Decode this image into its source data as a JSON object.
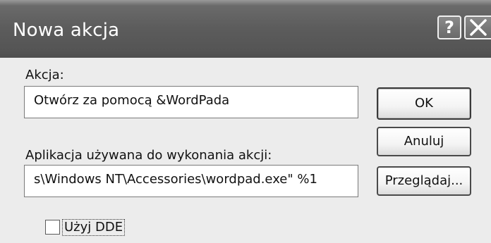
{
  "window": {
    "title": "Nowa akcja",
    "help_button": "?"
  },
  "form": {
    "action_label": "Akcja:",
    "action_value": "Otwórz za pomocą &WordPada",
    "app_label": "Aplikacja używana do wykonania akcji:",
    "app_value": "s\\Windows NT\\Accessories\\wordpad.exe\" %1",
    "dde_label": "Użyj DDE",
    "dde_checked": false
  },
  "buttons": {
    "ok": "OK",
    "cancel": "Anuluj",
    "browse": "Przeglądaj..."
  },
  "icons": [
    "help-icon",
    "close-icon"
  ]
}
